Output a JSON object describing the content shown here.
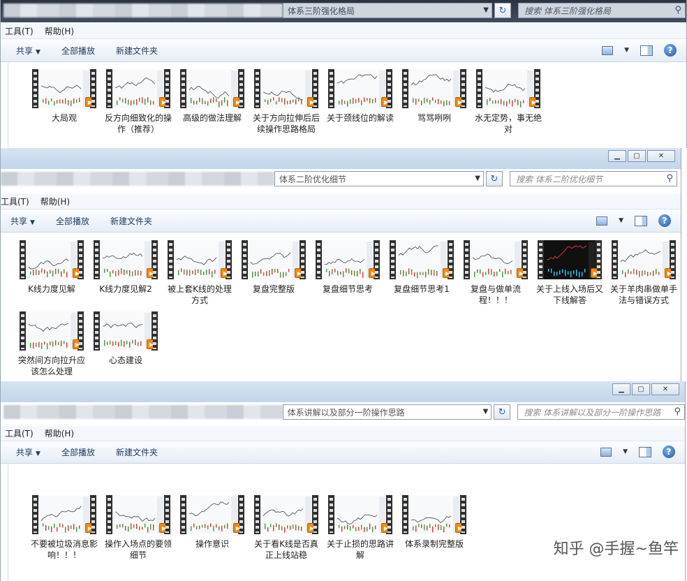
{
  "windows": [
    {
      "address": "体系三阶强化格局",
      "search_placeholder": "搜索 体系三阶强化格局",
      "menu": [
        "工具(T)",
        "帮助(H)"
      ],
      "commands": {
        "share": "共享",
        "play_all": "全部播放",
        "new_folder": "新建文件夹"
      },
      "items": [
        {
          "label": "大局观"
        },
        {
          "label": "反方向细致化的操作（推荐）"
        },
        {
          "label": "高级的做法理解"
        },
        {
          "label": "关于方向拉伸后后续操作思路格局"
        },
        {
          "label": "关于颈线位的解读"
        },
        {
          "label": "骂骂咧咧"
        },
        {
          "label": "水无定势，事无绝对"
        }
      ]
    },
    {
      "address": "体系二阶优化细节",
      "search_placeholder": "搜索 体系二阶优化细节",
      "menu": [
        "工具(T)",
        "帮助(H)"
      ],
      "commands": {
        "share": "共享",
        "play_all": "全部播放",
        "new_folder": "新建文件夹"
      },
      "items": [
        {
          "label": "K线力度见解"
        },
        {
          "label": "K线力度见解2"
        },
        {
          "label": "被上套K线的处理方式"
        },
        {
          "label": "复盘完整版"
        },
        {
          "label": "复盘细节思考"
        },
        {
          "label": "复盘细节思考1"
        },
        {
          "label": "复盘与做单流程！！！"
        },
        {
          "label": "关于上线入场后又下线解答"
        },
        {
          "label": "关于羊肉串做单手法与错误方式"
        },
        {
          "label": "突然间方向拉升应该怎么处理"
        },
        {
          "label": "心态建设"
        }
      ]
    },
    {
      "address": "体系讲解以及部分一阶操作思路",
      "search_placeholder": "搜索 体系讲解以及部分一阶操作思路",
      "menu": [
        "工具(T)",
        "帮助(H)"
      ],
      "commands": {
        "share": "共享",
        "play_all": "全部播放",
        "new_folder": "新建文件夹"
      },
      "items": [
        {
          "label": "不要被垃圾消息影响！！！"
        },
        {
          "label": "操作入场点的要领细节"
        },
        {
          "label": "操作意识"
        },
        {
          "label": "关于看K线是否真正上线站稳"
        },
        {
          "label": "关于止损的思路讲解"
        },
        {
          "label": "体系录制完整版"
        }
      ]
    }
  ],
  "icons": {
    "play": "play-badge-icon",
    "refresh": "refresh-icon",
    "search": "search-icon",
    "help": "help-icon"
  },
  "colors": {
    "play_badge": "#f08a12",
    "titlebar_dark": "#2b3340",
    "toolbar": "#e6edf6"
  },
  "watermark": "知乎 @手握~鱼竿"
}
